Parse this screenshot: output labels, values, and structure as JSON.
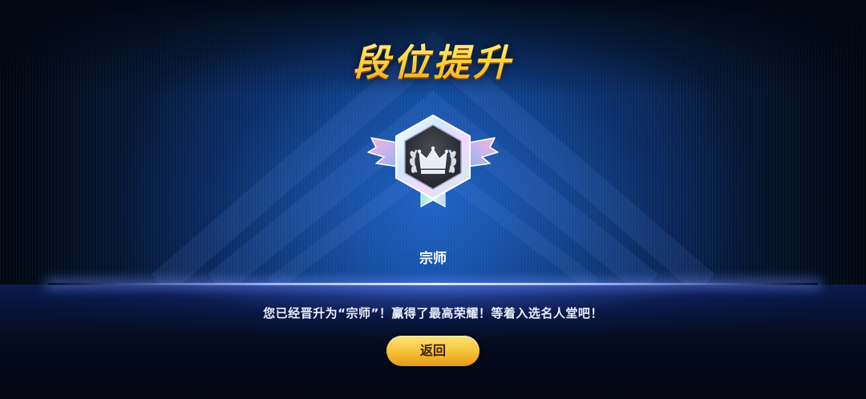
{
  "title": "段位提升",
  "rank": {
    "name": "宗师",
    "badge_icon": "crown-laurel-hexagon-badge-icon"
  },
  "message": "您已经晋升为“宗师”！赢得了最高荣耀！等着入选名人堂吧！",
  "buttons": {
    "return_label": "返回"
  },
  "colors": {
    "title_gold": "#ffd63a",
    "button_gold": "#f7c43b",
    "background_blue": "#0d4a95"
  }
}
